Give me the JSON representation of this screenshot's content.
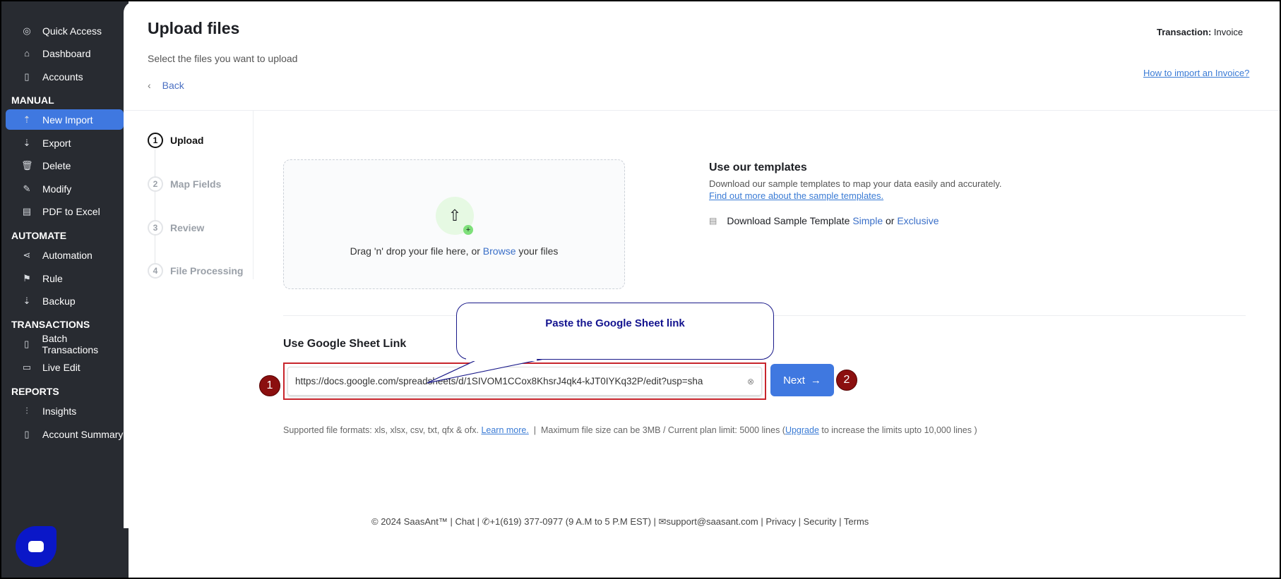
{
  "sidebar": {
    "items": [
      {
        "label": "Quick Access",
        "icon": "target-icon"
      },
      {
        "label": "Dashboard",
        "icon": "home-icon"
      },
      {
        "label": "Accounts",
        "icon": "clipboard-icon"
      }
    ],
    "sections": [
      {
        "title": "MANUAL",
        "items": [
          {
            "label": "New Import",
            "icon": "cloud-upload-icon",
            "active": true
          },
          {
            "label": "Export",
            "icon": "cloud-download-icon"
          },
          {
            "label": "Delete",
            "icon": "trash-icon"
          },
          {
            "label": "Modify",
            "icon": "file-edit-icon"
          },
          {
            "label": "PDF to Excel",
            "icon": "pdf-icon"
          }
        ]
      },
      {
        "title": "AUTOMATE",
        "items": [
          {
            "label": "Automation",
            "icon": "share-icon"
          },
          {
            "label": "Rule",
            "icon": "signpost-icon"
          },
          {
            "label": "Backup",
            "icon": "cloud-backup-icon"
          }
        ]
      },
      {
        "title": "TRANSACTIONS",
        "items": [
          {
            "label": "Batch Transactions",
            "icon": "document-icon"
          },
          {
            "label": "Live Edit",
            "icon": "edit-icon"
          }
        ]
      },
      {
        "title": "REPORTS",
        "items": [
          {
            "label": "Insights",
            "icon": "sliders-icon"
          },
          {
            "label": "Account Summary",
            "icon": "clipboard-icon"
          }
        ]
      }
    ]
  },
  "header": {
    "title": "Upload files",
    "subtitle": "Select the files you want to upload",
    "back": "Back",
    "transaction_label": "Transaction:",
    "transaction_value": "Invoice",
    "help_link": "How to import an Invoice?"
  },
  "steps": [
    {
      "num": "1",
      "label": "Upload"
    },
    {
      "num": "2",
      "label": "Map Fields"
    },
    {
      "num": "3",
      "label": "Review"
    },
    {
      "num": "4",
      "label": "File Processing"
    }
  ],
  "dropzone": {
    "pre": "Drag 'n' drop your file here, or ",
    "browse": "Browse",
    "post": " your files"
  },
  "templates": {
    "title": "Use our templates",
    "desc": "Download our sample templates to map your data easily and accurately.",
    "link": "Find out more about the sample templates.",
    "download_pre": "Download Sample Template",
    "simple": "Simple",
    "or": "or",
    "exclusive": "Exclusive"
  },
  "google_sheet": {
    "title": "Use Google Sheet Link",
    "value": "https://docs.google.com/spreadsheets/d/1SIVOM1CCox8KhsrJ4qk4-kJT0IYKq32P/edit?usp=sha",
    "next": "Next",
    "callout": "Paste the Google Sheet link",
    "marker1": "1",
    "marker2": "2"
  },
  "formats": {
    "text": "Supported file formats: xls, xlsx, csv, txt, qfx & ofx.",
    "learn": "Learn more.",
    "limits": "Maximum file size can be 3MB / Current plan limit: 5000 lines (",
    "upgrade": "Upgrade",
    "tail": " to increase the limits upto 10,000 lines )"
  },
  "footer": {
    "copyright": "© 2024 SaasAnt™",
    "chat": "Chat",
    "phone": "+1(619) 377-0977 (9 A.M to 5 P.M EST)",
    "email": "support@saasant.com",
    "privacy": "Privacy",
    "security": "Security",
    "terms": "Terms"
  },
  "colors": {
    "sidebar": "#282b31",
    "accent": "#3f78e0",
    "marker": "#8b0f0f",
    "chat": "#0a17c8"
  }
}
